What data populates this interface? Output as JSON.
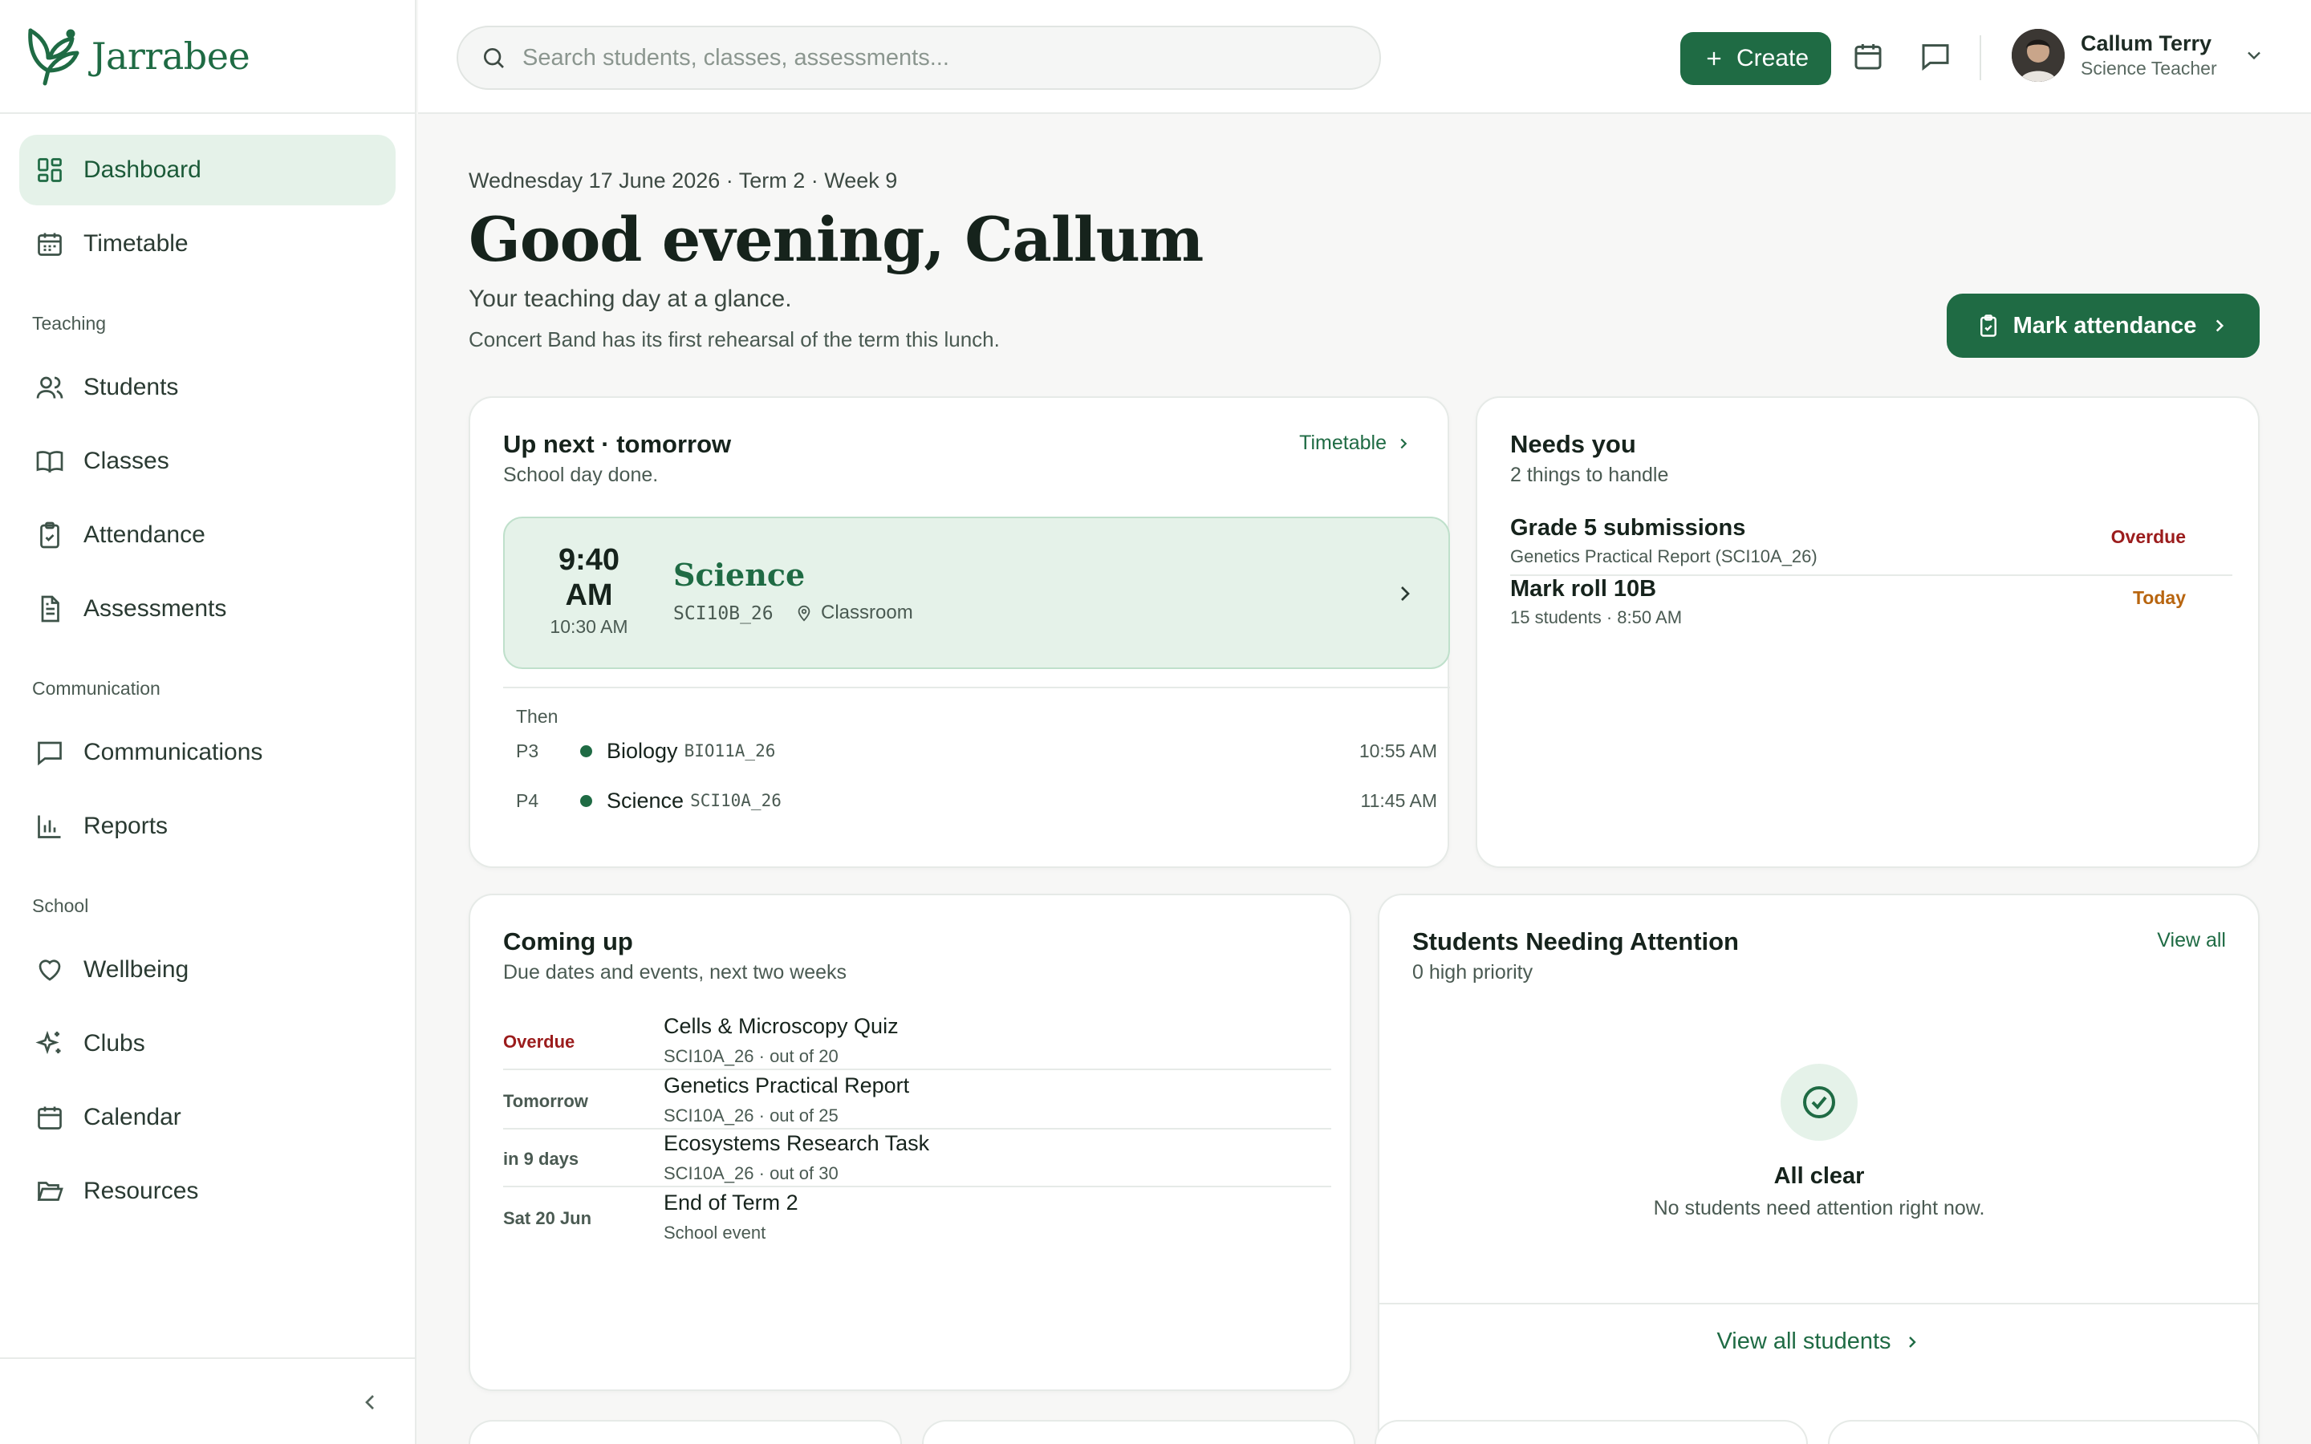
{
  "app": {
    "brand": "Jarrabee"
  },
  "sidebar": {
    "items": [
      {
        "label": "Dashboard",
        "icon": "dashboard-icon",
        "active": true
      },
      {
        "label": "Timetable",
        "icon": "calendar-icon"
      }
    ],
    "sections": [
      {
        "title": "Teaching",
        "items": [
          {
            "label": "Students",
            "icon": "users-icon"
          },
          {
            "label": "Classes",
            "icon": "book-icon"
          },
          {
            "label": "Attendance",
            "icon": "clipboard-check-icon"
          },
          {
            "label": "Assessments",
            "icon": "document-icon"
          }
        ]
      },
      {
        "title": "Communication",
        "items": [
          {
            "label": "Communications",
            "icon": "message-icon"
          },
          {
            "label": "Reports",
            "icon": "bar-chart-icon"
          }
        ]
      },
      {
        "title": "School",
        "items": [
          {
            "label": "Wellbeing",
            "icon": "heart-icon"
          },
          {
            "label": "Clubs",
            "icon": "sparkles-icon"
          },
          {
            "label": "Calendar",
            "icon": "calendar-icon"
          },
          {
            "label": "Resources",
            "icon": "folder-open-icon"
          }
        ]
      }
    ]
  },
  "header": {
    "search_placeholder": "Search students, classes, assessments...",
    "create_label": "Create",
    "user": {
      "name": "Callum Terry",
      "role": "Science Teacher"
    }
  },
  "page": {
    "date_line": "Wednesday 17 June 2026 · Term 2 · Week 9",
    "greeting": "Good evening, Callum",
    "subtitle": "Your teaching day at a glance.",
    "note": "Concert Band has its first rehearsal of the term this lunch.",
    "mark_attendance_label": "Mark attendance"
  },
  "up_next": {
    "title": "Up next · tomorrow",
    "subtitle": "School day done.",
    "link_label": "Timetable",
    "next": {
      "time": "9:40 AM",
      "end": "10:30 AM",
      "subject": "Science",
      "code": "SCI10B_26",
      "room": "Classroom"
    },
    "then_label": "Then",
    "then": [
      {
        "period": "P3",
        "subject": "Biology",
        "code": "BIO11A_26",
        "time": "10:55 AM"
      },
      {
        "period": "P4",
        "subject": "Science",
        "code": "SCI10A_26",
        "time": "11:45 AM"
      }
    ]
  },
  "needs_you": {
    "title": "Needs you",
    "subtitle": "2 things to handle",
    "items": [
      {
        "title": "Grade 5 submissions",
        "sub": "Genetics Practical Report (SCI10A_26)",
        "badge": "Overdue",
        "badge_color": "#9b1c1c"
      },
      {
        "title": "Mark roll 10B",
        "sub": "15 students · 8:50 AM",
        "badge": "Today",
        "badge_color": "#b8650f"
      }
    ]
  },
  "coming_up": {
    "title": "Coming up",
    "subtitle": "Due dates and events, next two weeks",
    "items": [
      {
        "when": "Overdue",
        "title": "Cells & Microscopy Quiz",
        "sub": "SCI10A_26 · out of 20"
      },
      {
        "when": "Tomorrow",
        "title": "Genetics Practical Report",
        "sub": "SCI10A_26 · out of 25"
      },
      {
        "when": "in 9 days",
        "title": "Ecosystems Research Task",
        "sub": "SCI10A_26 · out of 30"
      },
      {
        "when": "Sat 20 Jun",
        "title": "End of Term 2",
        "sub": "School event"
      }
    ]
  },
  "students_attention": {
    "title": "Students Needing Attention",
    "subtitle": "0 high priority",
    "link_label": "View all",
    "empty_title": "All clear",
    "empty_sub": "No students need attention right now.",
    "footer_link": "View all students"
  },
  "colors": {
    "accent": "#1f6b44",
    "accent_soft": "#e5f2e9",
    "overdue": "#9b1c1c",
    "today": "#b8650f"
  }
}
